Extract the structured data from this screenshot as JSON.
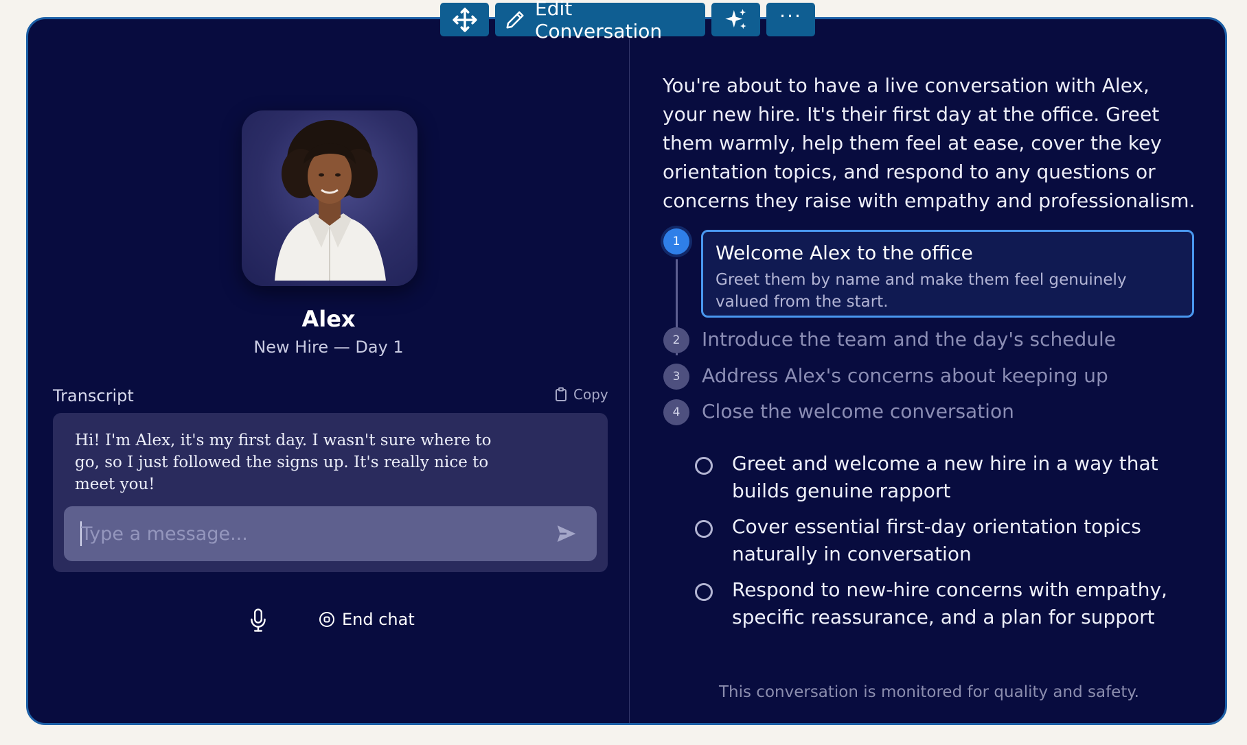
{
  "toolbar": {
    "move_icon": "move-arrows-icon",
    "edit_label": "Edit Conversation",
    "edit_icon": "pencil-icon",
    "ai_icon": "sparkle-icon",
    "more_label": "···"
  },
  "persona": {
    "name": "Alex",
    "role": "New Hire — Day 1",
    "avatar_icon": "person-avatar"
  },
  "transcript": {
    "label": "Transcript",
    "copy_label": "Copy",
    "message": "Hi! I'm Alex, it's my first day. I wasn't sure where to go, so I just followed the signs up. It's really nice to meet you!",
    "input_placeholder": "Type a message...",
    "send_icon": "send-icon"
  },
  "controls": {
    "mic_icon": "microphone-icon",
    "end_chat_label": "End chat"
  },
  "brief": {
    "intro": "You're about to have a live conversation with Alex, your new hire. It's their first day at the office. Greet them warmly, help them feel at ease, cover the key orientation topics, and respond to any questions or concerns they raise with empathy and professionalism."
  },
  "steps": [
    {
      "num": "1",
      "title": "Welcome Alex to the office",
      "desc": "Greet them by name and make them feel genuinely valued from the start.",
      "active": true
    },
    {
      "num": "2",
      "title": "Introduce the team and the day's schedule"
    },
    {
      "num": "3",
      "title": "Address Alex's concerns about keeping up"
    },
    {
      "num": "4",
      "title": "Close the welcome conversation"
    }
  ],
  "objectives": [
    "Greet and welcome a new hire in a way that builds genuine rapport",
    "Cover essential first-day orientation topics naturally in conversation",
    "Respond to new-hire concerns with empathy, specific reassurance, and a plan for support"
  ],
  "footer": "This conversation is monitored for quality and safety.",
  "colors": {
    "page_bg": "#f6f3ee",
    "panel_bg": "#080c3f",
    "frame_border": "#1c5fa6",
    "toolbar_bg": "#0f5e92",
    "active_step": "#2f7fe8"
  }
}
